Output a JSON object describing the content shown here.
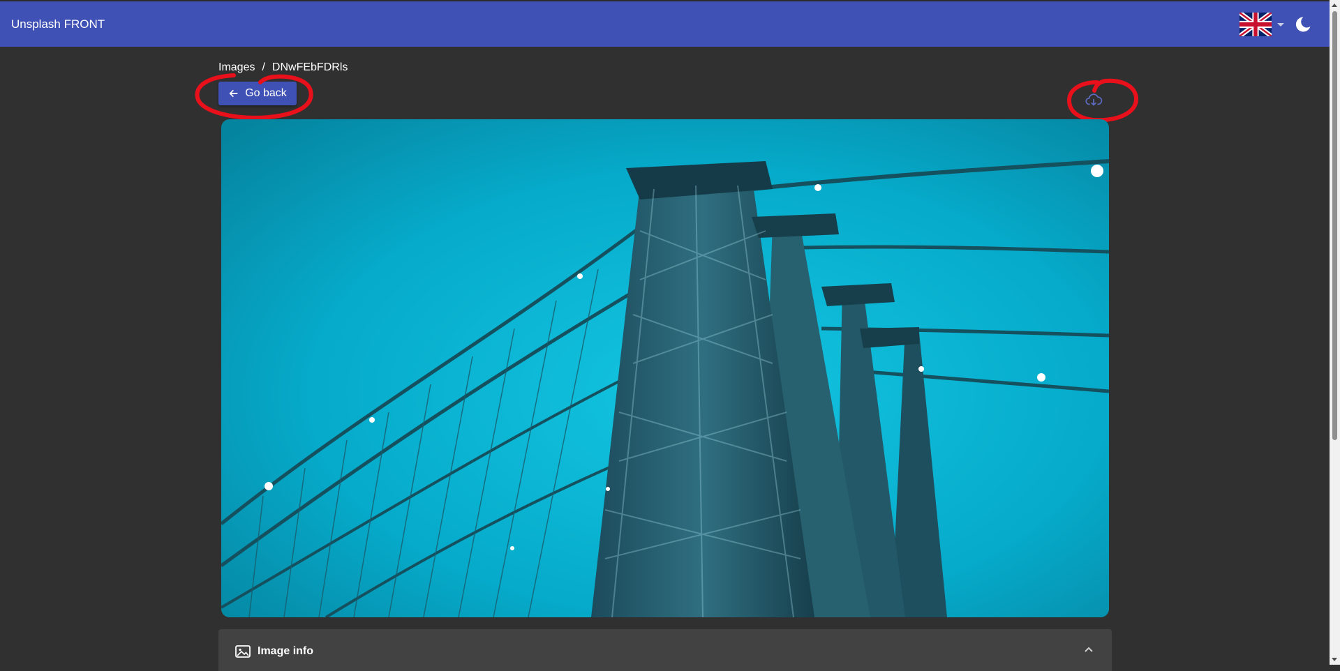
{
  "header": {
    "app_title": "Unsplash FRONT",
    "language_icon": "uk-flag-icon",
    "theme_icon": "moon-icon"
  },
  "breadcrumb": {
    "items": [
      "Images",
      "DNwFEbFDRls"
    ],
    "separator": "/"
  },
  "actions": {
    "go_back_label": "Go back",
    "go_back_icon": "arrow-left-icon",
    "download_icon": "cloud-download-icon"
  },
  "image": {
    "description": "Low-angle view of a suspension bridge tower with cables against a cyan sky"
  },
  "info_panel": {
    "title": "Image info",
    "icon": "image-icon",
    "toggle_icon": "chevron-up-icon"
  },
  "colors": {
    "primary": "#3f51b5",
    "background": "#303030",
    "panel": "#424242",
    "annotation": "#e8101a"
  }
}
